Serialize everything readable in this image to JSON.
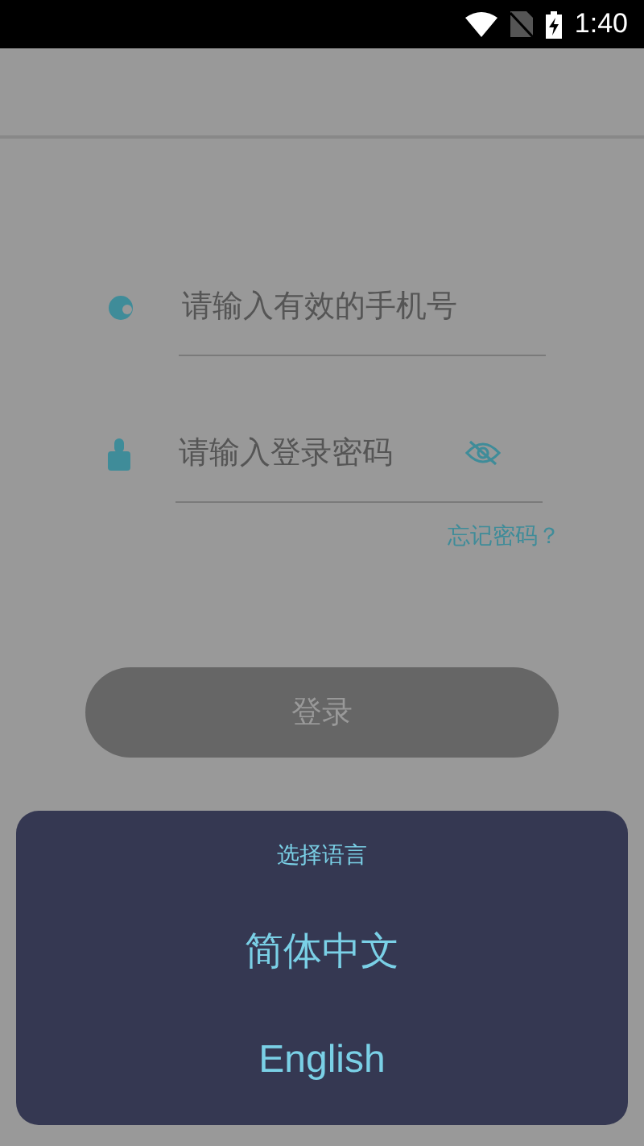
{
  "status_bar": {
    "time": "1:40"
  },
  "login_form": {
    "phone_field": {
      "placeholder": "请输入有效的手机号"
    },
    "password_field": {
      "placeholder": "请输入登录密码"
    },
    "forgot_password": "忘记密码？",
    "login_button": "登录"
  },
  "language_sheet": {
    "title": "选择语言",
    "options": [
      {
        "label": "简体中文"
      },
      {
        "label": "English"
      }
    ]
  }
}
